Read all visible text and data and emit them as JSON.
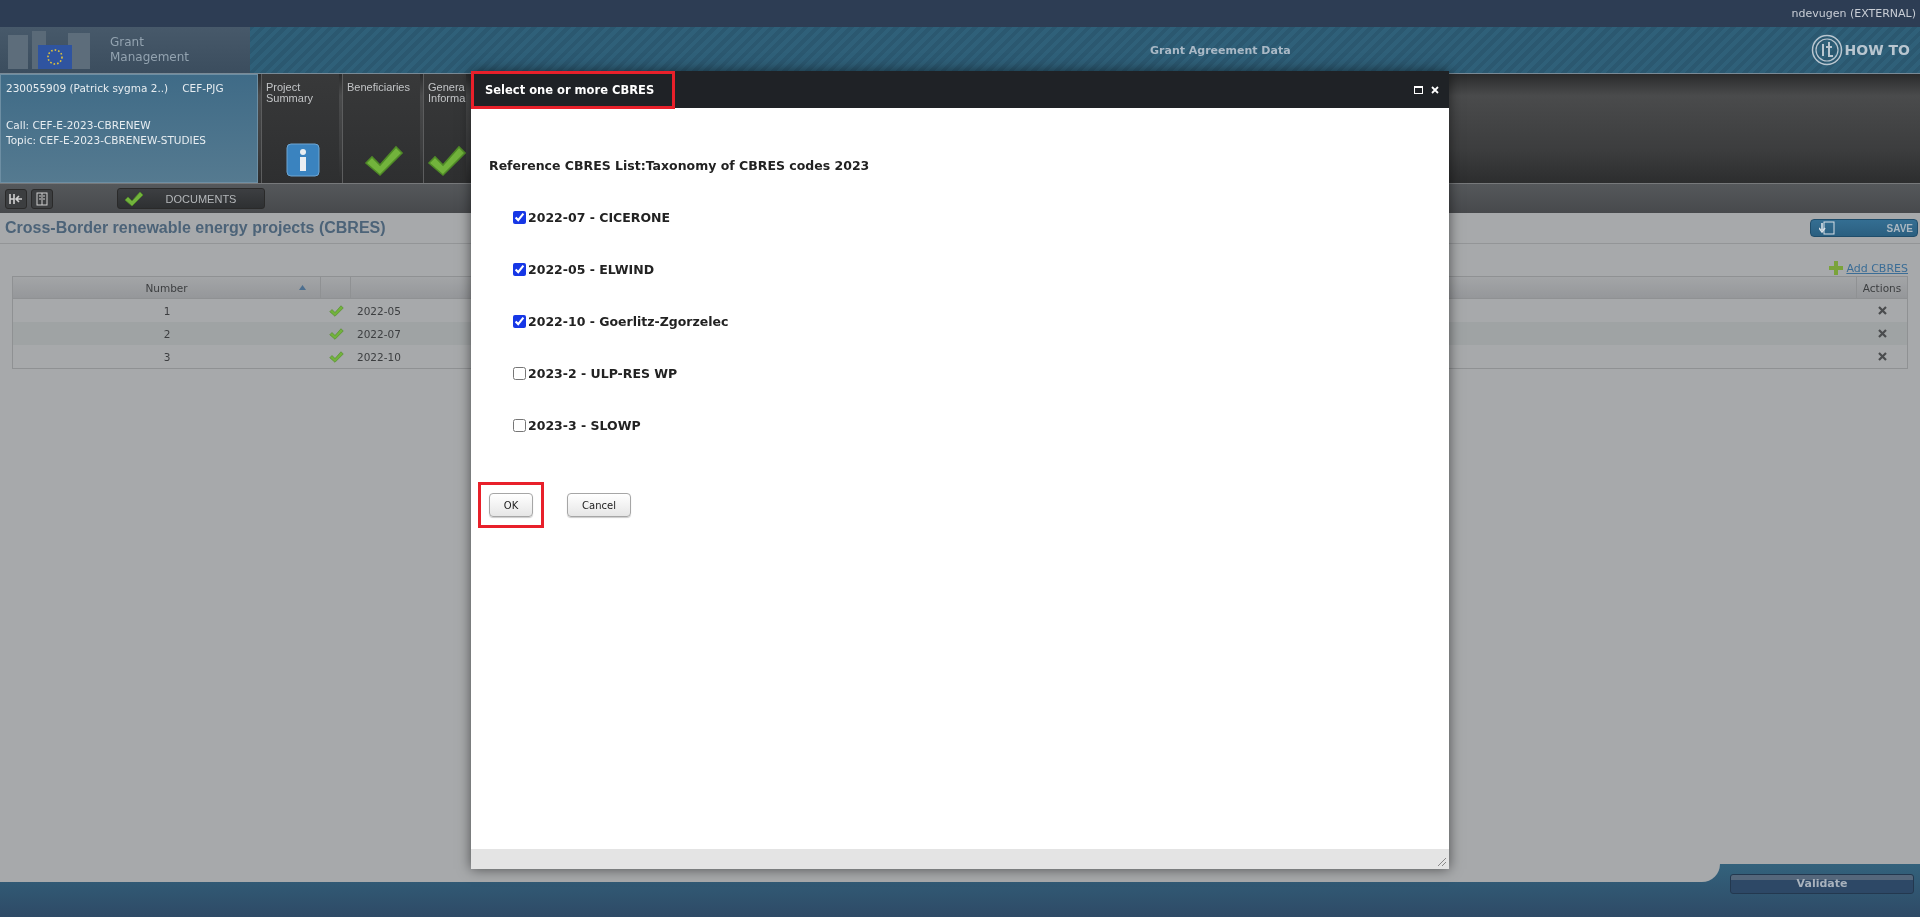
{
  "top_bar": {
    "user": "ndevugen (EXTERNAL)"
  },
  "header": {
    "app_name": "Grant Management",
    "title": "Grant Agreement Data",
    "help": "HOW TO"
  },
  "project": {
    "id": "230055909 (Patrick sygma 2..)",
    "programme": "CEF-PJG",
    "call": "Call: CEF-E-2023-CBRENEW",
    "topic": "Topic: CEF-E-2023-CBRENEW-STUDIES"
  },
  "tabs": [
    {
      "label": "Project Summary",
      "kind": "info"
    },
    {
      "label": "Beneficiaries",
      "kind": "done"
    },
    {
      "label": "Genera Informa",
      "kind": "done"
    }
  ],
  "toolbar": {
    "documents": "DOCUMENTS"
  },
  "section": {
    "title": "Cross-Border renewable energy projects (CBRES)",
    "save": "SAVE",
    "add_link": "Add CBRES"
  },
  "table": {
    "columns": {
      "number": "Number",
      "actions": "Actions"
    },
    "rows": [
      {
        "number": "1",
        "valid": true,
        "code": "2022-05"
      },
      {
        "number": "2",
        "valid": true,
        "code": "2022-07"
      },
      {
        "number": "3",
        "valid": true,
        "code": "2022-10"
      }
    ]
  },
  "dialog": {
    "title": "Select one or more CBRES",
    "title_highlighted": true,
    "heading": "Reference CBRES List:Taxonomy of CBRES codes 2023",
    "options": [
      {
        "label": "2022-07 - CICERONE",
        "checked": true
      },
      {
        "label": "2022-05 - ELWIND",
        "checked": true
      },
      {
        "label": "2022-10 - Goerlitz-Zgorzelec",
        "checked": true
      },
      {
        "label": "2023-2 - ULP-RES WP",
        "checked": false
      },
      {
        "label": "2023-3 - SLOWP",
        "checked": false
      }
    ],
    "buttons": [
      {
        "label": "OK",
        "highlighted": true
      },
      {
        "label": "Cancel",
        "highlighted": false
      }
    ]
  },
  "footer": {
    "validate": "Validate"
  }
}
